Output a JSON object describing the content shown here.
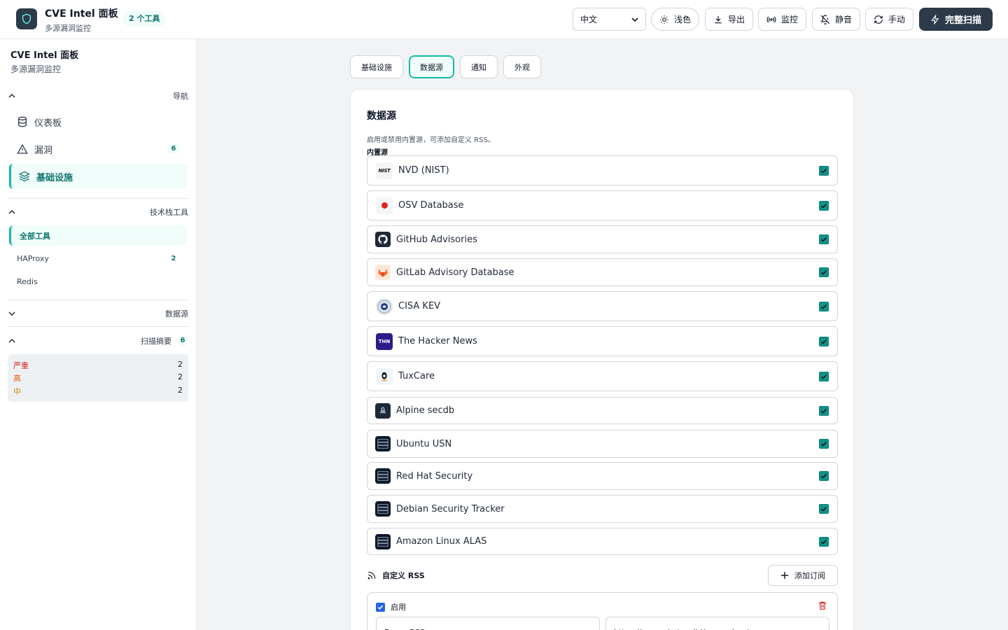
{
  "header": {
    "title": "CVE Intel 面板",
    "subtitle": "多源漏洞监控",
    "tool_badge": "2 个工具",
    "language": "中文",
    "buttons": {
      "theme": "浅色",
      "export": "导出",
      "monitor": "监控",
      "mute": "静音",
      "manual": "手动",
      "full_scan": "完整扫描"
    }
  },
  "sidebar": {
    "title": "CVE Intel 面板",
    "subtitle": "多源漏洞监控",
    "nav_section": "导航",
    "nav_items": [
      {
        "label": "仪表板"
      },
      {
        "label": "漏洞",
        "count": "6"
      },
      {
        "label": "基础设施",
        "active": true
      }
    ],
    "tools_section": "技术栈工具",
    "tools": [
      {
        "label": "全部工具",
        "active": true
      },
      {
        "label": "HAProxy",
        "count": "2"
      },
      {
        "label": "Redis"
      }
    ],
    "sources_section": "数据源",
    "summary_section": "扫描摘要",
    "summary_count": "6",
    "summary": [
      {
        "label": "严重",
        "count": "2",
        "color": "#dc2626"
      },
      {
        "label": "高",
        "count": "2",
        "color": "#ea580c"
      },
      {
        "label": "中",
        "count": "2",
        "color": "#ca8a04"
      }
    ]
  },
  "tabs": [
    {
      "label": "基础设施"
    },
    {
      "label": "数据源",
      "active": true
    },
    {
      "label": "通知"
    },
    {
      "label": "外观"
    }
  ],
  "datasources": {
    "title": "数据源",
    "description": "启用或禁用内置源，可添加自定义 RSS。",
    "builtin_label": "内置源",
    "sources": [
      {
        "name": "NVD (NIST)",
        "icon": "nist-logo-icon",
        "enabled": true
      },
      {
        "name": "OSV Database",
        "icon": "osv-logo-icon",
        "enabled": true
      },
      {
        "name": "GitHub Advisories",
        "icon": "github-logo-icon",
        "enabled": true
      },
      {
        "name": "GitLab Advisory Database",
        "icon": "gitlab-logo-icon",
        "enabled": true
      },
      {
        "name": "CISA KEV",
        "icon": "cisa-seal-icon",
        "enabled": true
      },
      {
        "name": "The Hacker News",
        "icon": "thn-logo-icon",
        "enabled": true
      },
      {
        "name": "TuxCare",
        "icon": "tuxcare-logo-icon",
        "enabled": true
      },
      {
        "name": "Alpine secdb",
        "icon": "alpine-logo-icon",
        "enabled": true
      },
      {
        "name": "Ubuntu USN",
        "icon": "server-icon",
        "enabled": true
      },
      {
        "name": "Red Hat Security",
        "icon": "server-icon",
        "enabled": true
      },
      {
        "name": "Debian Security Tracker",
        "icon": "server-icon",
        "enabled": true
      },
      {
        "name": "Amazon Linux ALAS",
        "icon": "server-icon",
        "enabled": true
      }
    ],
    "rss_title": "自定义 RSS",
    "add_button": "添加订阅",
    "rss_feed": {
      "enabled_label": "启用",
      "name": "Demo RSS",
      "url": "https://example.invalid/cve-radar-docs.rss"
    }
  },
  "colors": {
    "accent": "#0d9488",
    "primary_dark": "#2d3a4a"
  }
}
